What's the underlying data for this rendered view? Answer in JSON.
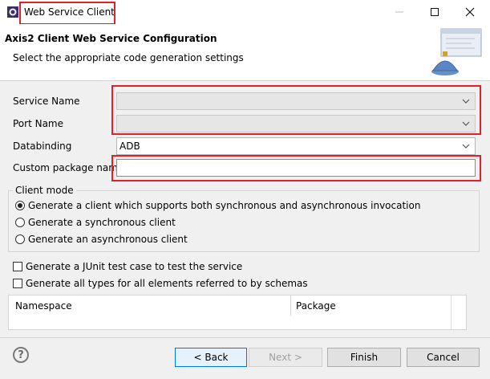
{
  "window": {
    "title": "Web Service Client"
  },
  "header": {
    "title": "Axis2 Client Web Service Configuration",
    "subtitle": "Select the appropriate code generation settings"
  },
  "form": {
    "service_name": {
      "label": "Service Name",
      "value": ""
    },
    "port_name": {
      "label": "Port Name",
      "value": ""
    },
    "databinding": {
      "label": "Databinding",
      "value": "ADB"
    },
    "custom_package": {
      "label": "Custom package name",
      "value": ""
    }
  },
  "client_mode": {
    "legend": "Client mode",
    "options": [
      {
        "label": "Generate a client which supports both synchronous and asynchronous invocation",
        "selected": true
      },
      {
        "label": "Generate a synchronous client",
        "selected": false
      },
      {
        "label": "Generate an asynchronous client",
        "selected": false
      }
    ]
  },
  "checkboxes": [
    {
      "label": "Generate a JUnit test case to test the service",
      "checked": false
    },
    {
      "label": "Generate all types for all elements referred to by schemas",
      "checked": false
    }
  ],
  "namespace_table": {
    "columns": [
      "Namespace",
      "Package"
    ],
    "rows": []
  },
  "buttons": {
    "back": "< Back",
    "next": "Next >",
    "finish": "Finish",
    "cancel": "Cancel",
    "help": "?"
  },
  "colors": {
    "highlight": "#e0202a",
    "default_button_border": "#0078d7"
  }
}
